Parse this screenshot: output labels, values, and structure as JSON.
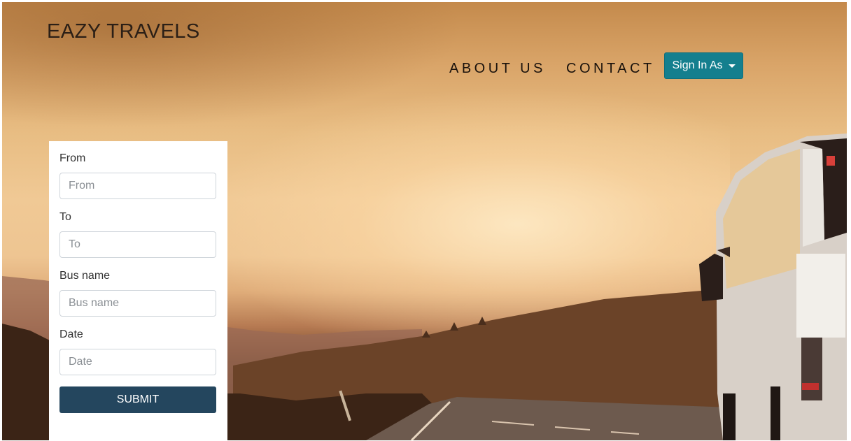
{
  "header": {
    "brand": "EAZY TRAVELS",
    "nav": {
      "about": "ABOUT US",
      "contact": "CONTACT",
      "signin": "Sign In As"
    }
  },
  "form": {
    "from_label": "From",
    "from_placeholder": "From",
    "to_label": "To",
    "to_placeholder": "To",
    "bus_label": "Bus name",
    "bus_placeholder": "Bus name",
    "date_label": "Date",
    "date_placeholder": "Date",
    "submit_label": "SUBMIT"
  },
  "colors": {
    "signin_button": "#147f8e",
    "submit_button": "#24465e"
  }
}
